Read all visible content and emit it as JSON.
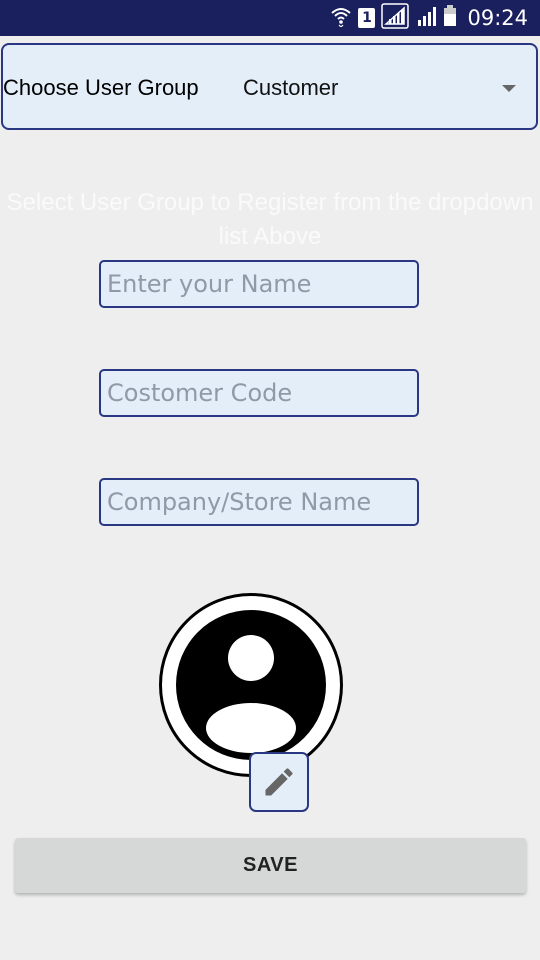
{
  "status_bar": {
    "time": "09:24",
    "icons": [
      "wifi-icon",
      "sim-1-icon",
      "signal-icon",
      "signal-icon-2",
      "battery-icon"
    ],
    "sim_number": "1",
    "background": "#1a1f5e"
  },
  "user_group": {
    "label": "Choose User Group",
    "selected": "Customer"
  },
  "hint": {
    "text": "Select User Group to Register from the dropdown list Above"
  },
  "form": {
    "name_placeholder": "Enter your Name",
    "code_placeholder": "Costomer Code",
    "company_placeholder": "Company/Store Name"
  },
  "avatar": {
    "icon": "account-circle-icon",
    "edit_icon": "pencil-icon"
  },
  "actions": {
    "save_label": "SAVE"
  },
  "colors": {
    "accent_border": "#2a3782",
    "field_background": "#e4eef9",
    "page_background": "#eeeeee"
  }
}
